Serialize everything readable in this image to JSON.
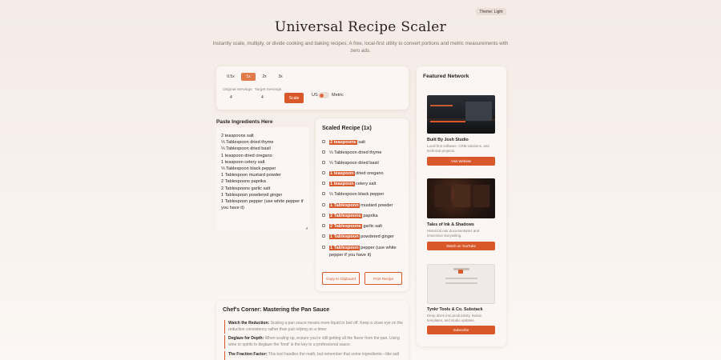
{
  "theme_badge": "Theme: Light",
  "hero": {
    "title": "Universal Recipe Scaler",
    "subtitle": "Instantly scale, multiply, or divide cooking and baking recipes. A free, local-first utility to convert portions and metric measurements with zero ads."
  },
  "controls": {
    "multipliers": [
      "0.5x",
      "1x",
      "2x",
      "3x"
    ],
    "active_multiplier": "1x",
    "original_label": "Original Servings",
    "target_label": "Target Servings",
    "original_value": "4",
    "target_value": "4",
    "scale_button": "Scale",
    "unit_us": "US",
    "unit_metric": "Metric"
  },
  "paste": {
    "heading": "Paste Ingredients Here",
    "lines": [
      "2 teaspoons salt",
      "⅓ Tablespoon dried thyme",
      "⅓ Tablespoon dried basil",
      "1 teaspoon dried oregano",
      "1 teaspoon celery salt",
      "⅓ Tablespoon black pepper",
      "1 Tablespoon mustard powder",
      "2 Tablespoons paprika",
      "2 Tablespoons garlic salt",
      "1 Tablespoon powdered ginger",
      "1 Tablespoon pepper (use white pepper if you have it)"
    ]
  },
  "scaled": {
    "heading": "Scaled Recipe (1x)",
    "items": [
      {
        "qty": "2 teaspoons",
        "rest": "salt",
        "highlight": true
      },
      {
        "qty": "⅓ Tablespoon",
        "rest": "dried thyme",
        "highlight": false
      },
      {
        "qty": "⅓ Tablespoon",
        "rest": "dried basil",
        "highlight": false
      },
      {
        "qty": "1 teaspoon",
        "rest": "dried oregano",
        "highlight": true
      },
      {
        "qty": "1 teaspoon",
        "rest": "celery salt",
        "highlight": true
      },
      {
        "qty": "⅓ Tablespoon",
        "rest": "black pepper",
        "highlight": false
      },
      {
        "qty": "1 Tablespoon",
        "rest": "mustard powder",
        "highlight": true
      },
      {
        "qty": "2 Tablespoons",
        "rest": "paprika",
        "highlight": true
      },
      {
        "qty": "2 Tablespoons",
        "rest": "garlic salt",
        "highlight": true
      },
      {
        "qty": "1 Tablespoon",
        "rest": "powdered ginger",
        "highlight": true
      },
      {
        "qty": "1 Tablespoon",
        "rest": "pepper (use white pepper if you have it)",
        "highlight": true
      }
    ],
    "copy_button": "Copy to Clipboard",
    "print_button": "Print Recipe"
  },
  "chef": {
    "heading": "Chef's Corner: Mastering the Pan Sauce",
    "tips": [
      {
        "title": "Watch the Reduction:",
        "body": "Scaling a pan sauce means more liquid to boil off. Keep a close eye on the reduction consistency rather than just relying on a timer."
      },
      {
        "title": "Deglaze for Depth:",
        "body": "When scaling up, ensure you're still getting all the flavor from the pan. Using wine or spirits to deglaze the 'fond' is the key to a professional sauce."
      },
      {
        "title": "The Fraction Factor:",
        "body": "This tool handles the math, but remember that some ingredients—like salt"
      }
    ]
  },
  "network": {
    "heading": "Featured Network",
    "items": [
      {
        "title": "Built By Josh Studio",
        "desc": "Local-first software, CRM solutions, and technical projects.",
        "button": "Visit Website"
      },
      {
        "title": "Tales of Ink & Shadows",
        "desc": "Historical noir documentaries and immersive storytelling.",
        "button": "Watch on YouTube"
      },
      {
        "title": "Tynkr Tools & Co. Substack",
        "desc": "Deep dives into productivity, Notion templates, and studio updates.",
        "button": "Subscribe"
      }
    ]
  },
  "colors": {
    "accent": "#d9582a",
    "background": "#f6eee9",
    "card": "#fbf6f3"
  }
}
